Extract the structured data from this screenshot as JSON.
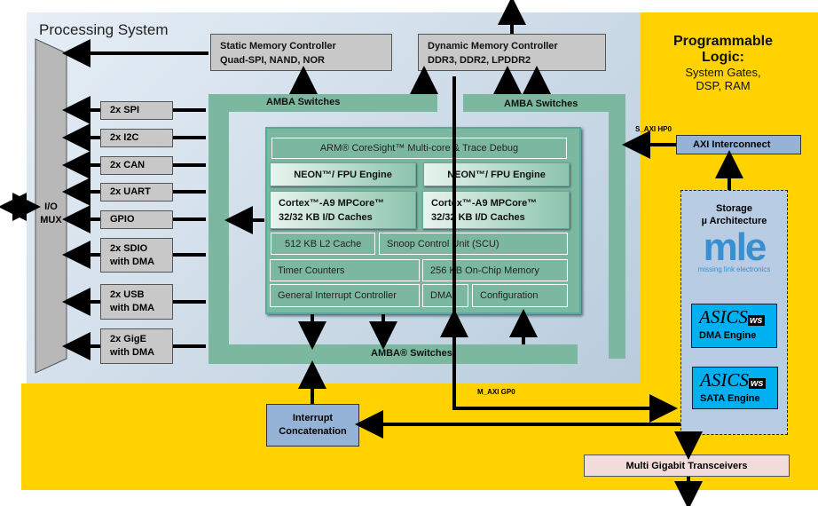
{
  "ps": {
    "title": "Processing System"
  },
  "pl": {
    "title1": "Programmable",
    "title2": "Logic:",
    "sub1": "System Gates,",
    "sub2": "DSP, RAM"
  },
  "iomux": {
    "l1": "I/O",
    "l2": "MUX"
  },
  "peripherals": [
    {
      "l1": "2x SPI"
    },
    {
      "l1": "2x I2C"
    },
    {
      "l1": "2x CAN"
    },
    {
      "l1": "2x UART"
    },
    {
      "l1": "GPIO"
    },
    {
      "l1": "2x SDIO",
      "l2": "with DMA"
    },
    {
      "l1": "2x USB",
      "l2": "with DMA"
    },
    {
      "l1": "2x GigE",
      "l2": "with DMA"
    }
  ],
  "static_mem": {
    "l1": "Static Memory Controller",
    "l2": "Quad-SPI, NAND, NOR"
  },
  "dynamic_mem": {
    "l1": "Dynamic Memory Controller",
    "l2": "DDR3, DDR2, LPDDR2"
  },
  "amba": {
    "top_left": "AMBA Switches",
    "top_right": "AMBA Switches",
    "bottom": "AMBA® Switches"
  },
  "core": {
    "coresight": "ARM® CoreSight™ Multi-core & Trace Debug",
    "neon": "NEON™/ FPU Engine",
    "cortex1": "Cortex™-A9 MPCore™",
    "cortex2": "32/32 KB I/D Caches",
    "l2": "512 KB L2 Cache",
    "scu": "Snoop Control Unit (SCU)",
    "timer": "Timer Counters",
    "ocm": "256 KB On-Chip Memory",
    "gic": "General Interrupt Controller",
    "dma": "DMA",
    "config": "Configuration"
  },
  "s_axi": "S_AXI HP0",
  "m_axi": "M_AXI GP0",
  "axi_interconnect": "AXI Interconnect",
  "storage": {
    "l1": "Storage",
    "l2": "µ Architecture",
    "logo": "mle",
    "logo_sub": "missing link electronics"
  },
  "asics": {
    "logo": "ASICS",
    "ws": "ws",
    "dma": "DMA Engine",
    "sata": "SATA Engine"
  },
  "interrupt": {
    "l1": "Interrupt",
    "l2": "Concatenation"
  },
  "mgt": "Multi Gigabit Transceivers"
}
